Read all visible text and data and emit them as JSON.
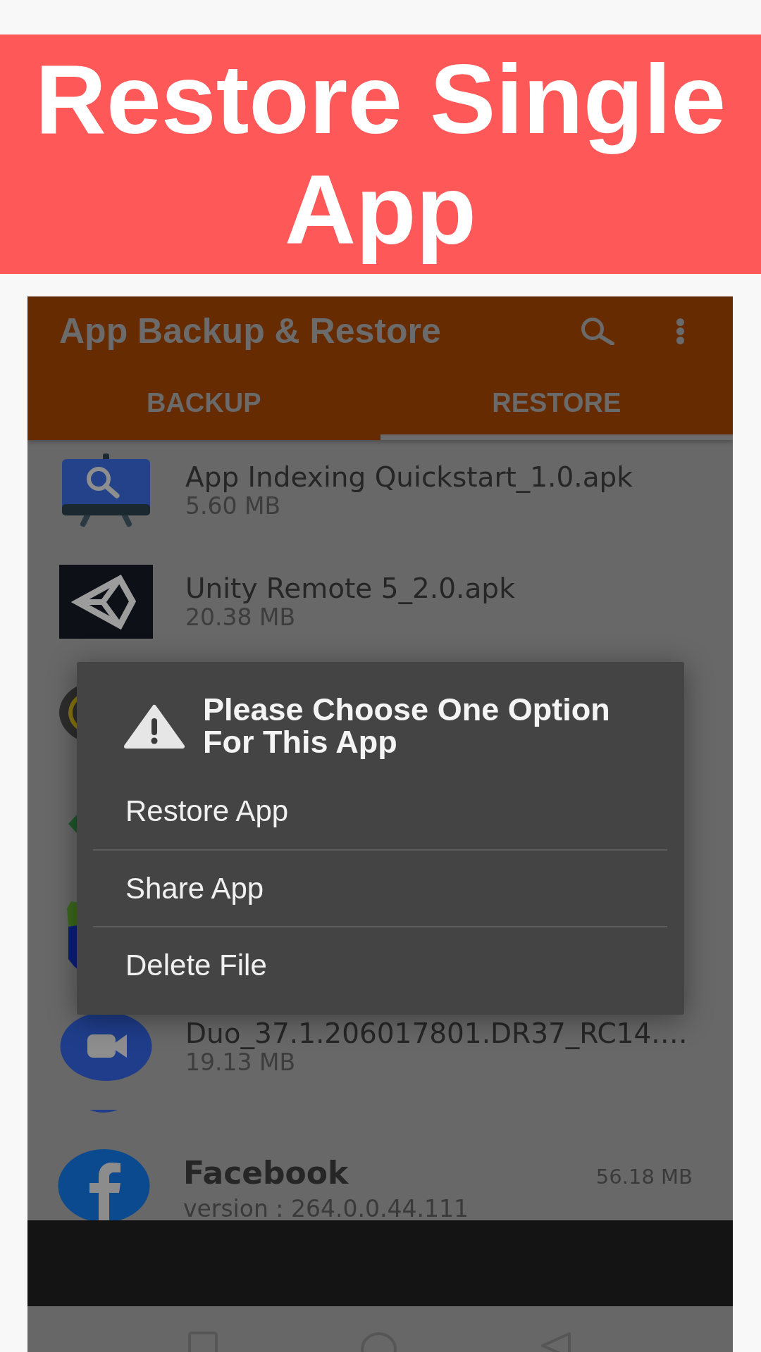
{
  "banner": {
    "title": "Restore Single App"
  },
  "app_bar": {
    "title": "App Backup & Restore"
  },
  "tabs": [
    {
      "label": "BACKUP",
      "selected": false
    },
    {
      "label": "RESTORE",
      "selected": true
    }
  ],
  "files": [
    {
      "kind": "file",
      "name": "App Indexing Quickstart_1.0.apk",
      "size": "5.60 MB"
    },
    {
      "kind": "file",
      "name": "Unity Remote 5_2.0.apk",
      "size": "20.38 MB"
    },
    {
      "kind": "covered"
    },
    {
      "kind": "covered"
    },
    {
      "kind": "covered"
    },
    {
      "kind": "file",
      "name": "Duo_37.1.206017801.DR37_RC14.…",
      "size": "19.13 MB"
    }
  ],
  "apps": [
    {
      "kind": "covered"
    },
    {
      "kind": "app",
      "name": "Facebook",
      "version": "version : 264.0.0.44.111",
      "size": "56.18 MB"
    }
  ],
  "dialog": {
    "title": "Please Choose One Option For This App",
    "options": [
      "Restore App",
      "Share App",
      "Delete File"
    ]
  }
}
